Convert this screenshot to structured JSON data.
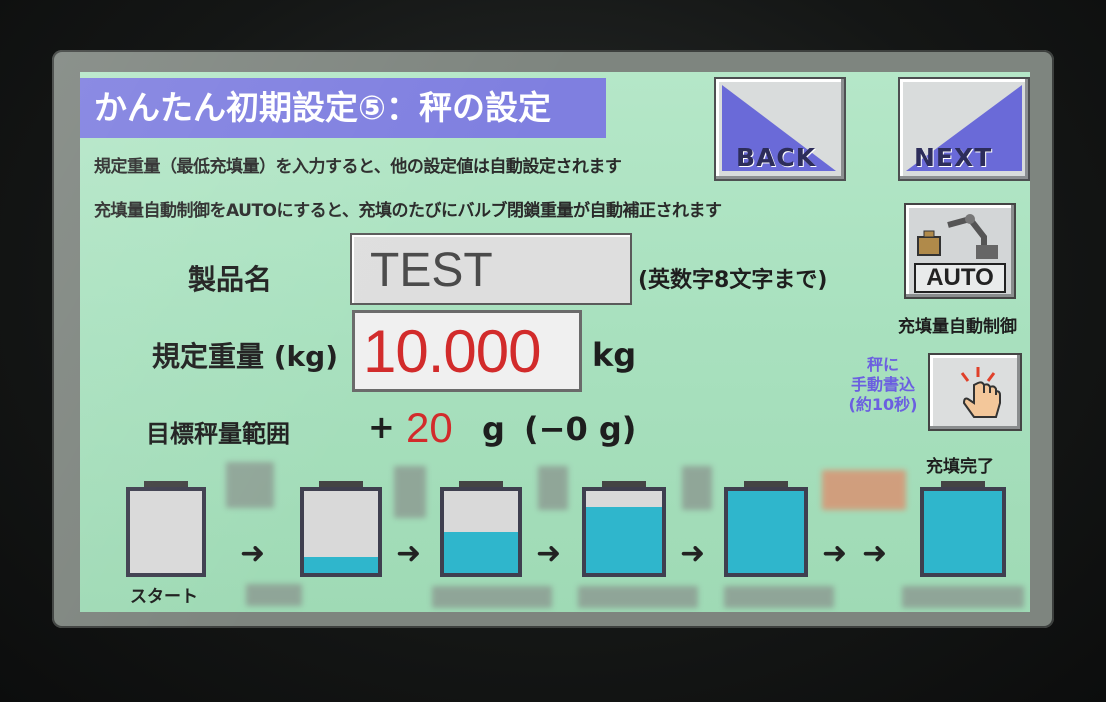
{
  "header": {
    "title": "かんたん初期設定⑤：秤の設定"
  },
  "info": {
    "line1": "規定重量（最低充填量）を入力すると、他の設定値は自動設定されます",
    "line2": "充填量自動制御をAUTOにすると、充填のたびにバルブ閉鎖重量が自動補正されます"
  },
  "nav": {
    "back_label": "BACK",
    "next_label": "NEXT"
  },
  "product": {
    "label": "製品名",
    "value": "TEST",
    "hint": "(英数字8文字まで)"
  },
  "weight": {
    "label": "規定重量 (kg)",
    "value": "10.000",
    "unit": "kg"
  },
  "target": {
    "label": "目標秤量範囲",
    "plus_sign": "+",
    "plus_value": "20",
    "plus_unit": "g",
    "minus": "(−0 g)"
  },
  "auto_control": {
    "button_label": "AUTO",
    "caption": "充填量自動制御"
  },
  "manual_write": {
    "line1": "秤に",
    "line2": "手動書込",
    "line3": "(約10秒)"
  },
  "process": {
    "start_label": "スタート",
    "end_label": "充填完了",
    "stages": [
      {
        "fill": 0.0
      },
      {
        "fill": 0.2
      },
      {
        "fill": 0.5
      },
      {
        "fill": 0.8
      },
      {
        "fill": 1.0
      },
      {
        "fill": 1.0
      }
    ]
  },
  "colors": {
    "title_bg": "#7f7fe0",
    "weight_value": "#d22b2b",
    "screen_bg": "#a9e1bf",
    "tank_fill": "#2fb6cc",
    "manual_label": "#6b5fe0"
  }
}
